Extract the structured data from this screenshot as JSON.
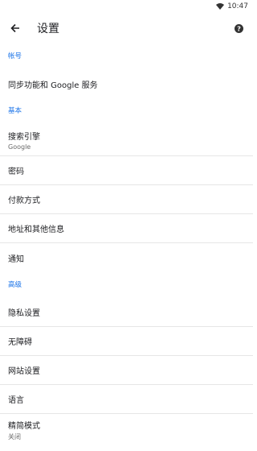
{
  "status_bar": {
    "time": "10:47",
    "wifi_icon": "wifi-icon"
  },
  "toolbar": {
    "title": "设置",
    "back_icon": "arrow-left-icon",
    "help_icon": "help-icon"
  },
  "sections": {
    "account": {
      "header": "帐号",
      "items": [
        {
          "label": "同步功能和 Google 服务"
        }
      ]
    },
    "basic": {
      "header": "基本",
      "items": [
        {
          "label": "搜索引擎",
          "sub": "Google"
        },
        {
          "label": "密码"
        },
        {
          "label": "付款方式"
        },
        {
          "label": "地址和其他信息"
        },
        {
          "label": "通知"
        }
      ]
    },
    "advanced": {
      "header": "高级",
      "items": [
        {
          "label": "隐私设置"
        },
        {
          "label": "无障碍"
        },
        {
          "label": "网站设置"
        },
        {
          "label": "语言"
        },
        {
          "label": "精简模式",
          "sub": "关闭"
        }
      ]
    }
  },
  "colors": {
    "accent": "#1a73e8",
    "divider": "#e6e6e6",
    "text": "#202124"
  }
}
